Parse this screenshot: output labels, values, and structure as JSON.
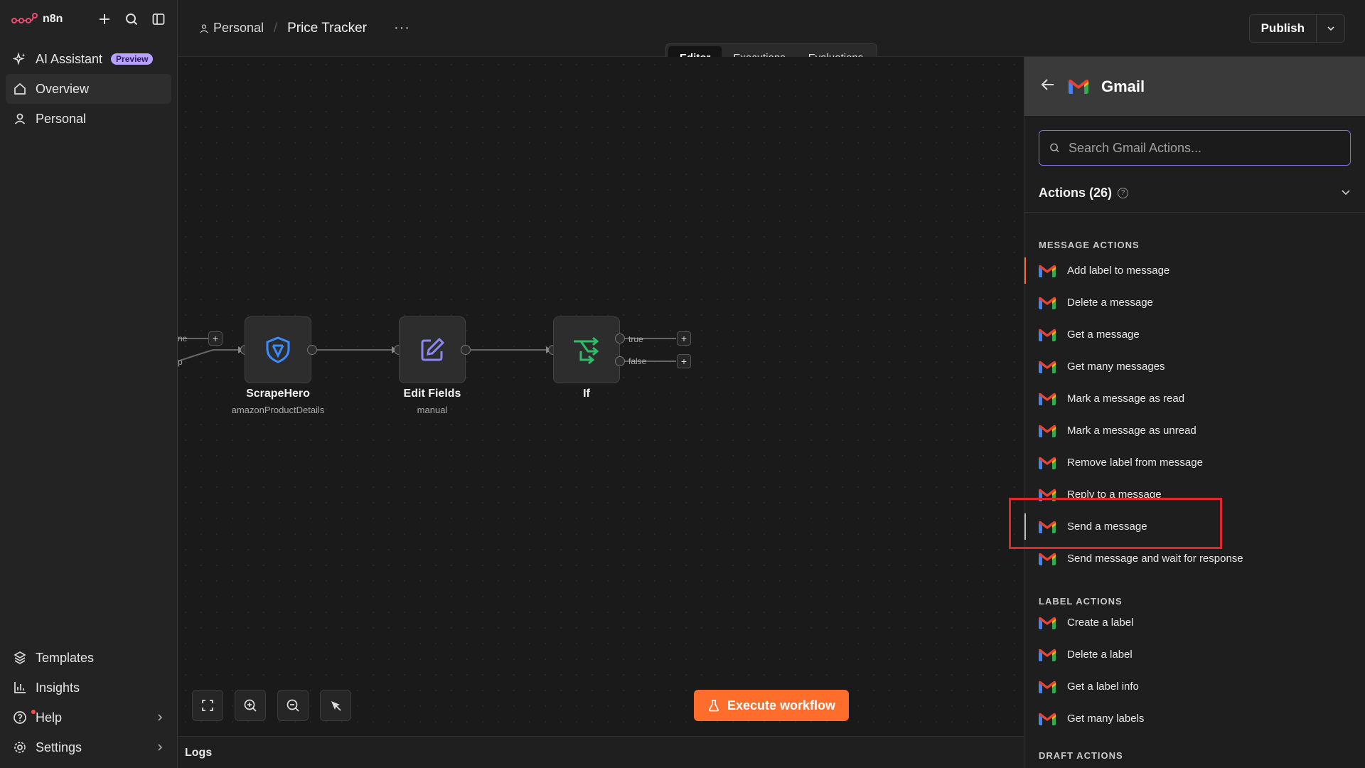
{
  "app": {
    "name": "n8n"
  },
  "sidebar": {
    "items": [
      {
        "label": "AI Assistant",
        "badge": "Preview"
      },
      {
        "label": "Overview"
      },
      {
        "label": "Personal"
      }
    ],
    "bottom": [
      {
        "label": "Templates"
      },
      {
        "label": "Insights"
      },
      {
        "label": "Help"
      },
      {
        "label": "Settings"
      }
    ]
  },
  "header": {
    "project": "Personal",
    "workflow_title": "Price Tracker",
    "tabs": [
      {
        "label": "Editor"
      },
      {
        "label": "Executions"
      },
      {
        "label": "Evaluations"
      }
    ],
    "active_tab": "Editor",
    "publish_label": "Publish"
  },
  "canvas": {
    "nodes": [
      {
        "label": "ScrapeHero",
        "sub": "amazonProductDetails"
      },
      {
        "label": "Edit Fields",
        "sub": "manual"
      },
      {
        "label": "If",
        "sub": ""
      }
    ],
    "left_labels": [
      "ne",
      "p"
    ],
    "branches": [
      "true",
      "false"
    ],
    "execute_label": "Execute workflow"
  },
  "logs": {
    "label": "Logs"
  },
  "panel": {
    "title": "Gmail",
    "search_placeholder": "Search Gmail Actions...",
    "actions_title": "Actions (26)",
    "sections": [
      {
        "title": "MESSAGE ACTIONS",
        "items": [
          "Add label to message",
          "Delete a message",
          "Get a message",
          "Get many messages",
          "Mark a message as read",
          "Mark a message as unread",
          "Remove label from message",
          "Reply to a message",
          "Send a message",
          "Send message and wait for response"
        ]
      },
      {
        "title": "LABEL ACTIONS",
        "items": [
          "Create a label",
          "Delete a label",
          "Get a label info",
          "Get many labels"
        ]
      },
      {
        "title": "DRAFT ACTIONS",
        "items": []
      }
    ],
    "highlighted_item": "Send a message"
  },
  "colors": {
    "accent": "#ff6d2d",
    "highlight": "#e3262b",
    "search_border": "#7b72e8"
  }
}
